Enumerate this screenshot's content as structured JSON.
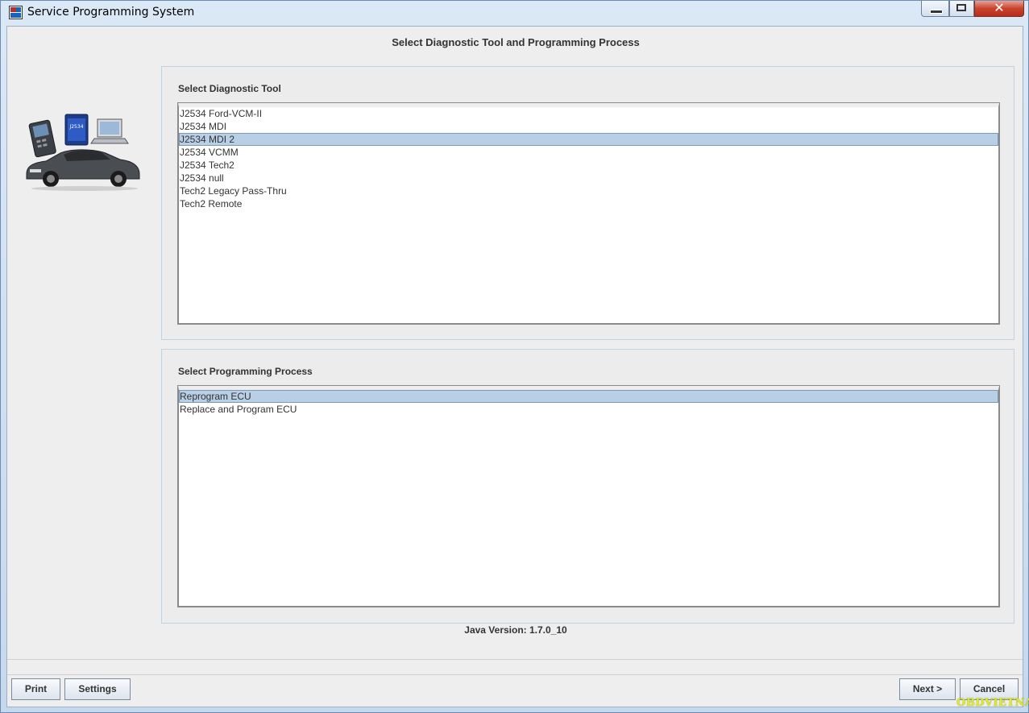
{
  "window": {
    "title": "Service Programming System",
    "close_glyph": "✕",
    "icons": [
      "app-icon",
      "minimize-icon",
      "maximize-icon",
      "close-icon"
    ]
  },
  "heading": "Select Diagnostic Tool and Programming Process",
  "logo_text": "J2534",
  "tool_section": {
    "label": "Select Diagnostic Tool",
    "selected_index": 2,
    "items": [
      "J2534 Ford-VCM-II",
      "J2534 MDI",
      "J2534 MDI 2",
      "J2534 VCMM",
      "J2534 Tech2",
      "J2534 null",
      "Tech2 Legacy Pass-Thru",
      "Tech2 Remote"
    ]
  },
  "process_section": {
    "label": "Select Programming Process",
    "selected_index": 0,
    "items": [
      "Reprogram ECU",
      "Replace and Program ECU"
    ]
  },
  "java_version": "Java Version: 1.7.0_10",
  "buttons": {
    "print": "Print",
    "settings": "Settings",
    "next": "Next >",
    "cancel": "Cancel"
  },
  "watermark": "OBDVIETNAM",
  "colors": {
    "selection": "#b8cfe5",
    "close_button": "#c9432e"
  }
}
